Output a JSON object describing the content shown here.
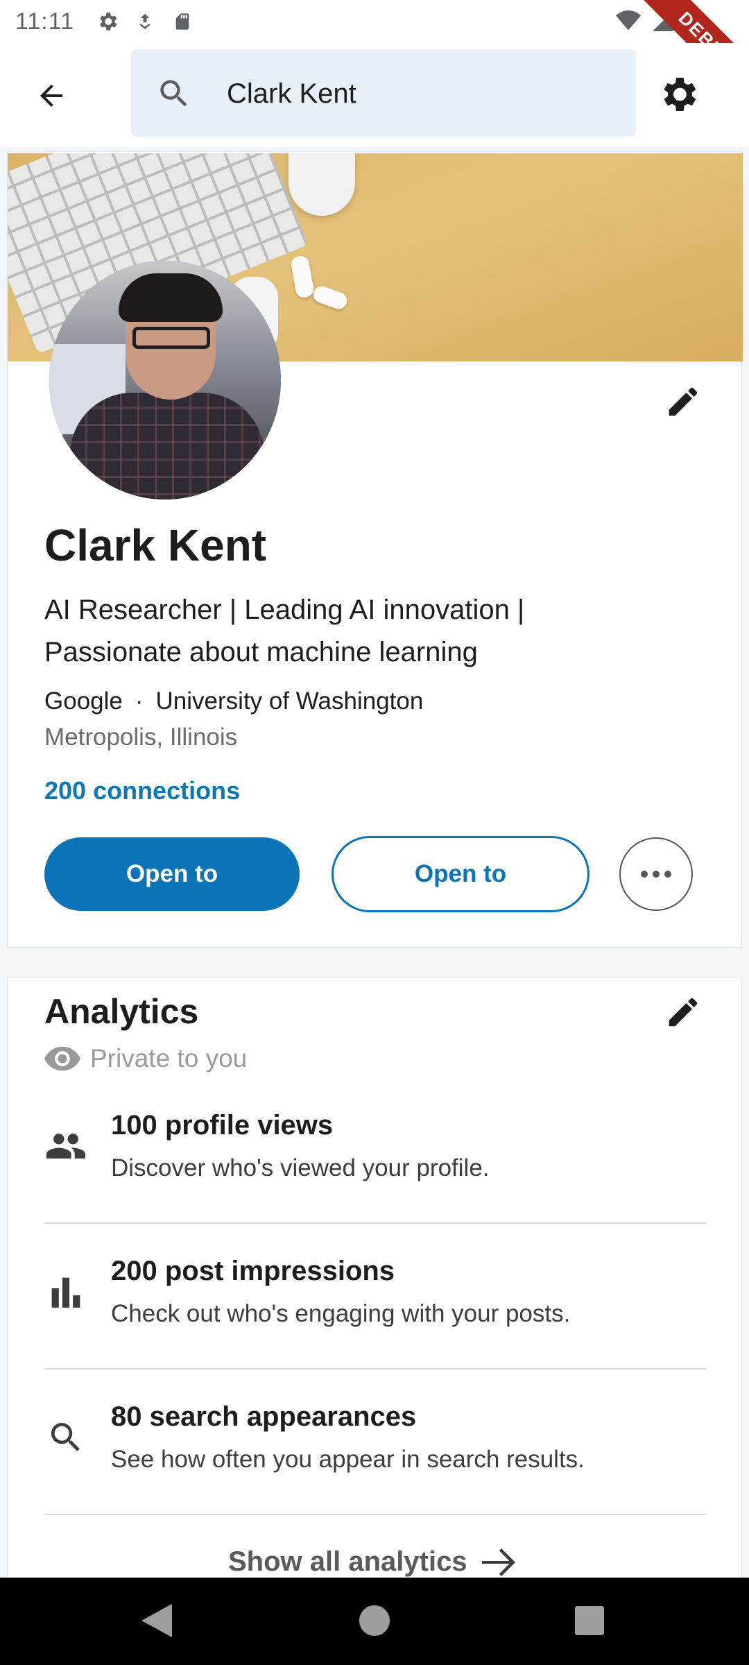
{
  "status_bar": {
    "time": "11:11",
    "debug_label": "DEBUG"
  },
  "search": {
    "query": "Clark Kent"
  },
  "profile": {
    "name": "Clark Kent",
    "headline": "AI Researcher | Leading AI innovation | Passionate about machine learning",
    "company": "Google",
    "separator": "·",
    "school": "University of Washington",
    "location": "Metropolis, Illinois",
    "connections": "200 connections",
    "primary_button": "Open to",
    "secondary_button": "Open to"
  },
  "analytics": {
    "title": "Analytics",
    "privacy": "Private to you",
    "items": [
      {
        "icon": "people-icon",
        "title": "100 profile views",
        "subtitle": "Discover who's viewed your profile."
      },
      {
        "icon": "bar-chart-icon",
        "title": "200 post impressions",
        "subtitle": "Check out who's engaging with your posts."
      },
      {
        "icon": "search-icon",
        "title": "80 search appearances",
        "subtitle": "See how often you appear in search results."
      }
    ],
    "show_all": "Show all analytics"
  },
  "colors": {
    "accent": "#0b73b7",
    "link": "#0b78b8",
    "banner": "#e0bb70"
  }
}
